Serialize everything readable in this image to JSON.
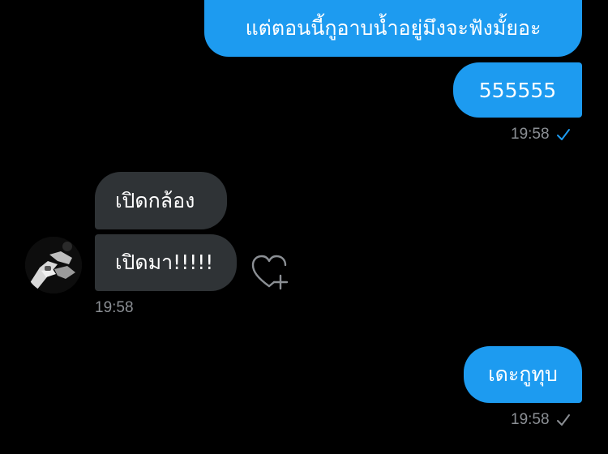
{
  "messages": {
    "out1": {
      "text": "แต่ตอนนี้กูอาบน้ำอยู่มึงจะฟังมั้ยอะ"
    },
    "out2": {
      "text": "555555"
    },
    "out_group1_time": "19:58",
    "in1": {
      "text": "เปิดกล้อง"
    },
    "in2": {
      "text": "เปิดมา!!!!!"
    },
    "in_group_time": "19:58",
    "out3": {
      "text": "เดะกูทุบ"
    },
    "out_group2_time": "19:58"
  },
  "icons": {
    "read_receipt": "check-icon",
    "react": "heart-plus-icon",
    "avatar": "avatar"
  },
  "colors": {
    "background": "#000000",
    "outgoing_bubble": "#1d9bf0",
    "incoming_bubble": "#2f3336",
    "timestamp": "#8b8f94",
    "read_check": "#1d9bf0",
    "sent_check": "#8b8f94"
  }
}
